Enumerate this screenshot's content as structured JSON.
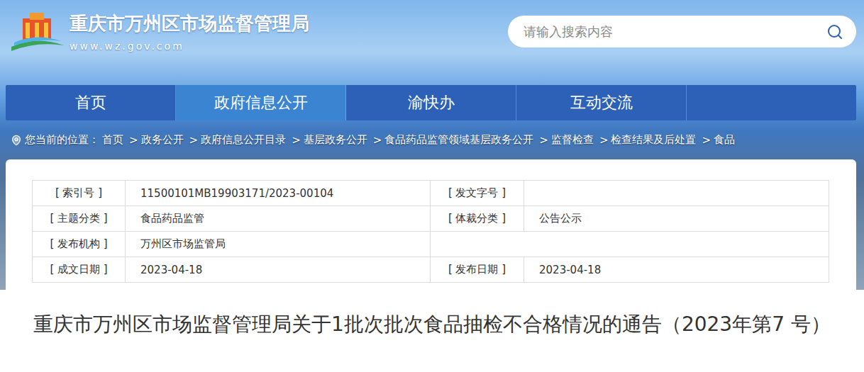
{
  "site": {
    "title": "重庆市万州区市场监督管理局",
    "domain": "www.wz.gov.com"
  },
  "search": {
    "placeholder": "请输入搜索内容"
  },
  "nav": [
    {
      "label": "首页",
      "selected": false
    },
    {
      "label": "政府信息公开",
      "selected": true
    },
    {
      "label": "渝快办",
      "selected": false
    },
    {
      "label": "互动交流",
      "selected": false
    }
  ],
  "breadcrumb": {
    "prefix": "您当前的位置：",
    "separator": ">",
    "items": [
      "首页",
      "政务公开",
      "政府信息公开目录",
      "基层政务公开",
      "食品药品监管领域基层政务公开",
      "监督检查",
      "检查结果及后处置",
      "食品"
    ]
  },
  "meta": [
    [
      {
        "label": "[ 索引号 ]",
        "value": "11500101MB19903171/2023-00104"
      },
      {
        "label": "[ 发文字号 ]",
        "value": ""
      }
    ],
    [
      {
        "label": "[ 主题分类 ]",
        "value": "食品药品监管"
      },
      {
        "label": "[ 体裁分类 ]",
        "value": "公告公示"
      }
    ],
    [
      {
        "label": "[ 发布机构 ]",
        "value": "万州区市场监管局"
      }
    ],
    [
      {
        "label": "[ 成文日期 ]",
        "value": "2023-04-18"
      },
      {
        "label": "[ 发布日期 ]",
        "value": "2023-04-18"
      }
    ]
  ],
  "article": {
    "title": "重庆市万州区市场监督管理局关于1批次批次食品抽检不合格情况的通告（2023年第7 号）"
  }
}
